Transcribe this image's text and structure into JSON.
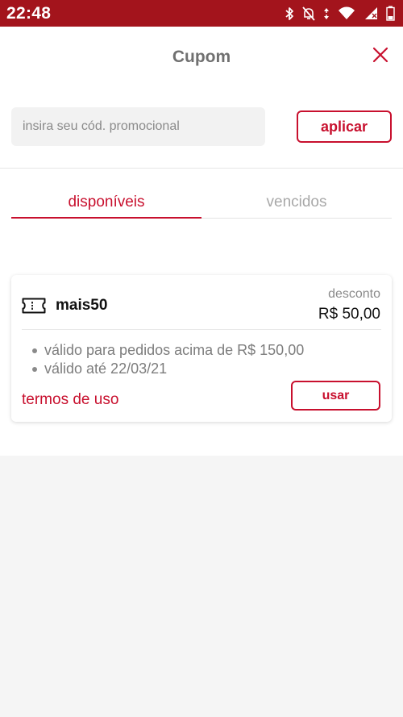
{
  "status_bar": {
    "time": "22:48",
    "icons": [
      "bluetooth-icon",
      "notifications-off-icon",
      "data-arrows-icon",
      "wifi-icon",
      "cellular-signal-icon",
      "battery-icon"
    ]
  },
  "header": {
    "title": "Cupom",
    "close_icon": "close-icon"
  },
  "promo": {
    "placeholder": "insira seu cód. promocional",
    "value": "",
    "apply_label": "aplicar"
  },
  "tabs": [
    {
      "label": "disponíveis",
      "active": true
    },
    {
      "label": "vencidos",
      "active": false
    }
  ],
  "coupons": [
    {
      "code": "mais50",
      "icon": "ticket-icon",
      "discount_label": "desconto",
      "discount_value": "R$ 50,00",
      "rules": [
        "válido para pedidos acima de R$ 150,00",
        "válido até 22/03/21"
      ],
      "terms_label": "termos de uso",
      "use_label": "usar"
    }
  ],
  "colors": {
    "status_bar": "#a3141c",
    "accent": "#c8102e",
    "background": "#f5f5f5",
    "muted_text": "#8a8a8a"
  }
}
